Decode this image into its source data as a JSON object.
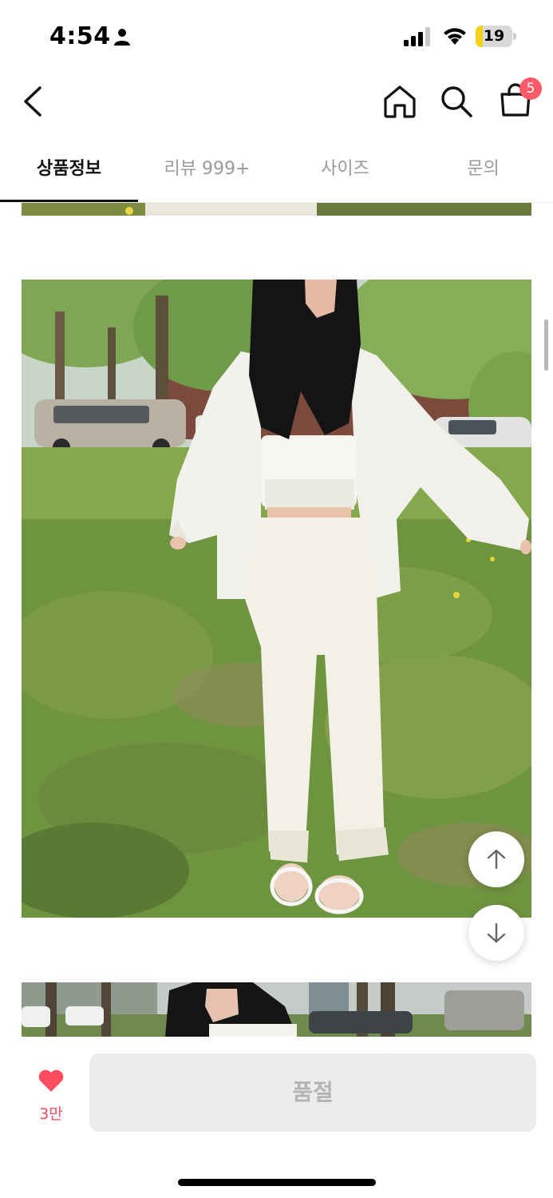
{
  "status_bar": {
    "time": "4:54",
    "battery_level": "19",
    "battery_fraction": 0.19,
    "icons": [
      "person-icon",
      "signal-icon",
      "wifi-icon",
      "battery-icon"
    ]
  },
  "nav": {
    "icons": [
      "back-icon",
      "home-icon",
      "search-icon",
      "cart-icon"
    ],
    "cart_badge": "5"
  },
  "tabs": [
    {
      "label": "상품정보",
      "active": true
    },
    {
      "label": "리뷰 999+",
      "active": false
    },
    {
      "label": "사이즈",
      "active": false
    },
    {
      "label": "문의",
      "active": false
    }
  ],
  "floating_buttons": [
    "arrow-up-icon",
    "arrow-down-icon"
  ],
  "bottom_bar": {
    "like_count": "3만",
    "soldout_label": "품절"
  },
  "colors": {
    "accent": "#ff4b5f",
    "badge": "#ff5a6a",
    "battery_fill": "#f2d21b",
    "disabled_button": "#ececec"
  }
}
